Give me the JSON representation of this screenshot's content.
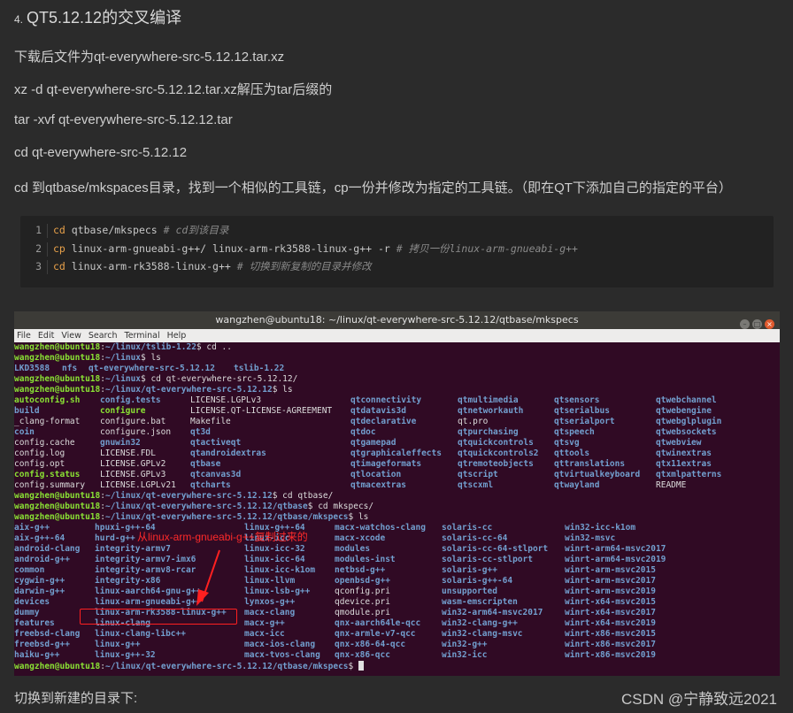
{
  "article": {
    "heading_num": "4.",
    "heading_title": "QT5.12.12的交叉编译",
    "paragraphs": [
      "下载后文件为qt-everywhere-src-5.12.12.tar.xz",
      "xz -d qt-everywhere-src-5.12.12.tar.xz解压为tar后缀的",
      "tar -xvf qt-everywhere-src-5.12.12.tar",
      "cd qt-everywhere-src-5.12.12",
      "cd 到qtbase/mkspaces目录，找到一个相似的工具链，cp一份并修改为指定的工具链。（即在QT下添加自己的指定的平台）"
    ],
    "footer": "切换到新建的目录下:",
    "watermark": "CSDN @宁静致远2021"
  },
  "code_block": {
    "lines": [
      {
        "num": "1",
        "cmd": "cd",
        "args": " qtbase/mkspecs ",
        "comment": "# cd到该目录"
      },
      {
        "num": "2",
        "cmd": "cp",
        "args": " linux-arm-gnueabi-g++/ linux-arm-rk3588-linux-g++ -r ",
        "comment": "# 拷贝一份linux-arm-gnueabi-g++"
      },
      {
        "num": "3",
        "cmd": "cd",
        "args": " linux-arm-rk3588-linux-g++ ",
        "comment": "#  切换到新复制的目录并修改"
      }
    ]
  },
  "terminal": {
    "title": "wangzhen@ubuntu18: ~/linux/qt-everywhere-src-5.12.12/qtbase/mkspecs",
    "menu": [
      "File",
      "Edit",
      "View",
      "Search",
      "Terminal",
      "Help"
    ],
    "prompt_user": "wangzhen@ubuntu18",
    "lines": [
      {
        "path": "~/linux/tslib-1.22",
        "cmd": "$ cd .."
      },
      {
        "path": "~/linux",
        "cmd": "$ ls"
      },
      {
        "path": "~/linux",
        "cmd": "$ cd qt-everywhere-src-5.12.12/"
      },
      {
        "path": "~/linux/qt-everywhere-src-5.12.12",
        "cmd": "$ ls"
      },
      {
        "path": "~/linux/qt-everywhere-src-5.12.12",
        "cmd": "$ cd qtbase/"
      },
      {
        "path": "~/linux/qt-everywhere-src-5.12.12/qtbase",
        "cmd": "$ cd mkspecs/"
      },
      {
        "path": "~/linux/qt-everywhere-src-5.12.12/qtbase/mkspecs",
        "cmd": "$ ls"
      },
      {
        "path": "~/linux/qt-everywhere-src-5.12.12/qtbase/mkspecs",
        "cmd": "$ "
      }
    ],
    "ls1": [
      "LKD3588",
      "nfs",
      "qt-everywhere-src-5.12.12",
      "tslib-1.22"
    ],
    "ls2_rows": [
      [
        "autoconfig.sh",
        "config.tests",
        "LICENSE.LGPLv3",
        "qtconnectivity",
        "qtmultimedia",
        "qtsensors",
        "qtwebchannel"
      ],
      [
        "build",
        "configure",
        "LICENSE.QT-LICENSE-AGREEMENT",
        "qtdatavis3d",
        "qtnetworkauth",
        "qtserialbus",
        "qtwebengine"
      ],
      [
        "_clang-format",
        "configure.bat",
        "Makefile",
        "qtdeclarative",
        "qt.pro",
        "qtserialport",
        "qtwebglplugin"
      ],
      [
        "coin",
        "configure.json",
        "qt3d",
        "qtdoc",
        "qtpurchasing",
        "qtspeech",
        "qtwebsockets"
      ],
      [
        "config.cache",
        "gnuwin32",
        "qtactiveqt",
        "qtgamepad",
        "qtquickcontrols",
        "qtsvg",
        "qtwebview"
      ],
      [
        "config.log",
        "LICENSE.FDL",
        "qtandroidextras",
        "qtgraphicaleffects",
        "qtquickcontrols2",
        "qttools",
        "qtwinextras"
      ],
      [
        "config.opt",
        "LICENSE.GPLv2",
        "qtbase",
        "qtimageformats",
        "qtremoteobjects",
        "qttranslations",
        "qtx11extras"
      ],
      [
        "config.status",
        "LICENSE.GPLv3",
        "qtcanvas3d",
        "qtlocation",
        "qtscript",
        "qtvirtualkeyboard",
        "qtxmlpatterns"
      ],
      [
        "config.summary",
        "LICENSE.LGPLv21",
        "qtcharts",
        "qtmacextras",
        "qtscxml",
        "qtwayland",
        "README"
      ]
    ],
    "ls3_rows": [
      [
        "aix-g++",
        "hpuxi-g++-64",
        "linux-g++-64",
        "macx-watchos-clang",
        "solaris-cc",
        "win32-icc-k1om"
      ],
      [
        "aix-g++-64",
        "hurd-g++",
        "linux-icc",
        "macx-xcode",
        "solaris-cc-64",
        "win32-msvc"
      ],
      [
        "android-clang",
        "integrity-armv7",
        "linux-icc-32",
        "modules",
        "solaris-cc-64-stlport",
        "winrt-arm64-msvc2017"
      ],
      [
        "android-g++",
        "integrity-armv7-imx6",
        "linux-icc-64",
        "modules-inst",
        "solaris-cc-stlport",
        "winrt-arm64-msvc2019"
      ],
      [
        "common",
        "integrity-armv8-rcar",
        "linux-icc-k1om",
        "netbsd-g++",
        "solaris-g++",
        "winrt-arm-msvc2015"
      ],
      [
        "cygwin-g++",
        "integrity-x86",
        "linux-llvm",
        "openbsd-g++",
        "solaris-g++-64",
        "winrt-arm-msvc2017"
      ],
      [
        "darwin-g++",
        "linux-aarch64-gnu-g++",
        "linux-lsb-g++",
        "qconfig.pri",
        "unsupported",
        "winrt-arm-msvc2019"
      ],
      [
        "devices",
        "linux-arm-gnueabi-g++",
        "lynxos-g++",
        "qdevice.pri",
        "wasm-emscripten",
        "winrt-x64-msvc2015"
      ],
      [
        "dummy",
        "linux-arm-rk3588-linux-g++",
        "macx-clang",
        "qmodule.pri",
        "win32-arm64-msvc2017",
        "winrt-x64-msvc2017"
      ],
      [
        "features",
        "linux-clang",
        "macx-g++",
        "qnx-aarch64le-qcc",
        "win32-clang-g++",
        "winrt-x64-msvc2019"
      ],
      [
        "freebsd-clang",
        "linux-clang-libc++",
        "macx-icc",
        "qnx-armle-v7-qcc",
        "win32-clang-msvc",
        "winrt-x86-msvc2015"
      ],
      [
        "freebsd-g++",
        "linux-g++",
        "macx-ios-clang",
        "qnx-x86-64-qcc",
        "win32-g++",
        "winrt-x86-msvc2017"
      ],
      [
        "haiku-g++",
        "linux-g++-32",
        "macx-tvos-clang",
        "qnx-x86-qcc",
        "win32-icc",
        "winrt-x86-msvc2019"
      ]
    ]
  },
  "annotation": {
    "text": "从linux-arm-gnueabi-g++复制过来的",
    "color": "#ff2020"
  }
}
